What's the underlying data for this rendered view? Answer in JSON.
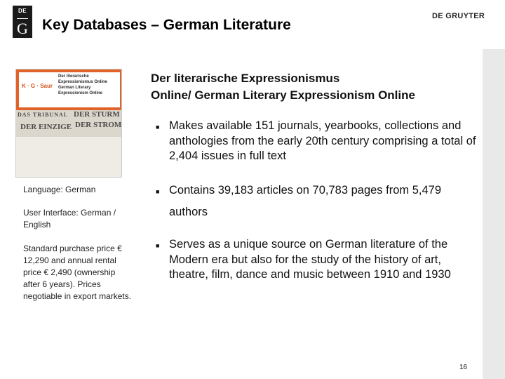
{
  "header": {
    "logo": {
      "top": "DE",
      "bottom": "G"
    },
    "title": "Key Databases – German Literature",
    "brand": "DE GRUYTER"
  },
  "cover": {
    "publisher": "K · G · Saur",
    "lines": [
      "Der literarische",
      "Expressionismus Online",
      "German Literary",
      "Expressionism Online"
    ],
    "collage": [
      "DAS TRIBUNAL",
      "DER STURM",
      "DER EINZIGE",
      "DER STROM"
    ]
  },
  "meta": {
    "language": "Language: German",
    "interface": "User Interface: German / English",
    "pricing": "Standard purchase price € 12,290 and annual rental price € 2,490 (ownership after 6 years). Prices negotiable in export markets."
  },
  "main": {
    "heading_line1": "Der literarische Expressionismus",
    "heading_line2": "Online/ German Literary Expressionism Online",
    "bullet_symbol": "■",
    "bullets": [
      "Makes available 151 journals, yearbooks, collections and anthologies from the early 20th century comprising a total of 2,404 issues in full text",
      "Contains 39,183 articles on 70,783 pages from 5,479",
      "authors",
      "Serves as a unique source on German literature of the Modern era but also for the study of the history of art, theatre, film, dance and music between 1910 and 1930"
    ]
  },
  "page_number": "16",
  "colors": {
    "cover_orange": "#e2632a",
    "publisher_orange": "#d2541c",
    "band_gray": "#e9e9e9"
  }
}
